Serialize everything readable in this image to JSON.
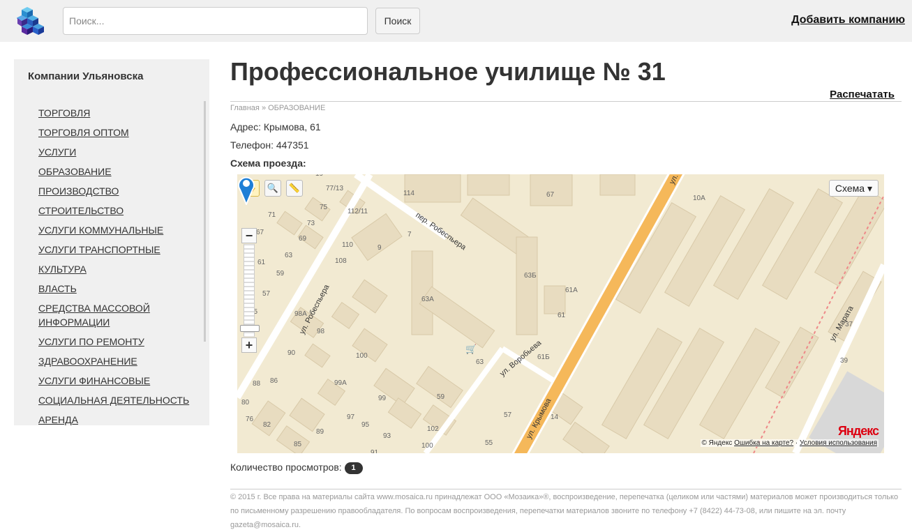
{
  "header": {
    "search_placeholder": "Поиск...",
    "search_button": "Поиск",
    "add_company": "Добавить компанию"
  },
  "sidebar": {
    "title": "Компании Ульяновска",
    "items": [
      "ТОРГОВЛЯ",
      "ТОРГОВЛЯ ОПТОМ",
      "УСЛУГИ",
      "ОБРАЗОВАНИЕ",
      "ПРОИЗВОДСТВО",
      "СТРОИТЕЛЬСТВО",
      "УСЛУГИ КОММУНАЛЬНЫЕ",
      "УСЛУГИ ТРАНСПОРТНЫЕ",
      "КУЛЬТУРА",
      "ВЛАСТЬ",
      "СРЕДСТВА МАССОВОЙ ИНФОРМАЦИИ",
      "УСЛУГИ ПО РЕМОНТУ",
      "ЗДРАВООХРАНЕНИЕ",
      "УСЛУГИ ФИНАНСОВЫЕ",
      "СОЦИАЛЬНАЯ ДЕЯТЕЛЬНОСТЬ",
      "АРЕНДА"
    ]
  },
  "main": {
    "title": "Профессиональное училище № 31",
    "print_link": "Распечатать",
    "breadcrumb": {
      "home": "Главная",
      "separator": "»",
      "category": "ОБРАЗОВАНИЕ"
    },
    "address": "Адрес: Крымова, 61",
    "phone": "Телефон: 447351",
    "route_label": "Схема проезда:",
    "views_label": "Количество просмотров:",
    "views_count": "1"
  },
  "map": {
    "layer_button": "Схема",
    "logo": "Яндекс",
    "copyright": "© Яндекс",
    "report_error": "Ошибка на карте?",
    "separator": "·",
    "terms": "Условия использования",
    "street_labels": [
      "ул. Робеспьера",
      "пер. Робеспьера",
      "ул. Воробьева",
      "ул. Крымова",
      "ул. Марата",
      "ул. К"
    ],
    "house_numbers": [
      "19",
      "77/13",
      "114",
      "67",
      "10А",
      "75",
      "112/11",
      "71",
      "73",
      "7",
      "67",
      "69",
      "9",
      "110",
      "63",
      "108",
      "61",
      "59",
      "63Б",
      "57",
      "61А",
      "63А",
      "98А",
      "55",
      "61",
      "37",
      "98",
      "90",
      "100",
      "63",
      "61Б",
      "39",
      "88",
      "86",
      "99А",
      "59",
      "80",
      "99",
      "97",
      "57",
      "14",
      "76",
      "82",
      "95",
      "89",
      "102",
      "93",
      "85",
      "100",
      "55",
      "91"
    ],
    "accent_color": "#f5b85a",
    "marker_color": "#1e7fd6"
  },
  "footer": {
    "text": "© 2015 г. Все права на материалы сайта www.mosaica.ru принадлежат ООО «Мозаика»®, воспроизведение, перепечатка (целиком или частями) материалов может производиться только по письменному разрешению правообладателя. По вопросам воспроизведения, перепечатки материалов звоните по телефону +7 (8422) 44-73-08, или пишите на эл. почту gazeta@mosaica.ru."
  }
}
